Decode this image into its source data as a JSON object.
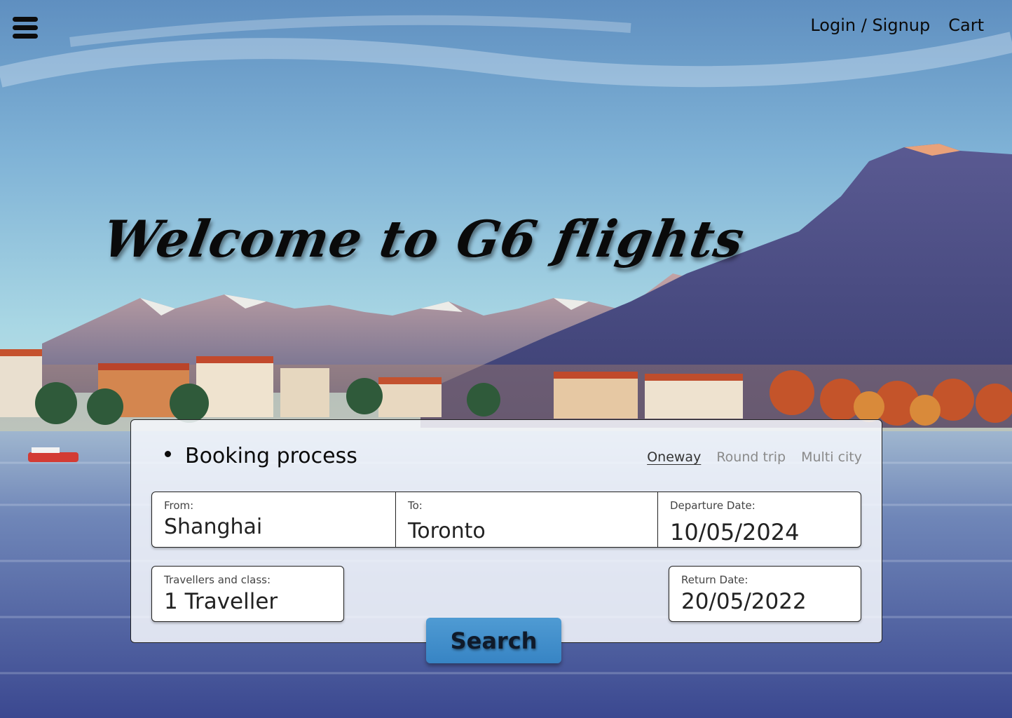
{
  "header": {
    "menu_icon": "hamburger-menu-icon",
    "nav_links": [
      "Login / Signup",
      "Cart"
    ]
  },
  "hero": {
    "title": "Welcome to G6 flights"
  },
  "booking": {
    "heading": "Booking process",
    "trip_types": [
      {
        "label": "Oneway",
        "active": true
      },
      {
        "label": "Round trip",
        "active": false
      },
      {
        "label": "Multi city",
        "active": false
      }
    ],
    "from": {
      "label": "From:",
      "value": "Shanghai"
    },
    "to": {
      "label": "To:",
      "value": "Toronto"
    },
    "departure": {
      "label": "Departure Date:",
      "value": "10/05/2024"
    },
    "travellers": {
      "label": "Travellers and class:",
      "value": "1 Traveller"
    },
    "return": {
      "label": "Return Date:",
      "value": "20/05/2022"
    },
    "search_label": "Search"
  },
  "colors": {
    "search_button": "#3d8bc9",
    "card_background": "#f6f8fd"
  }
}
